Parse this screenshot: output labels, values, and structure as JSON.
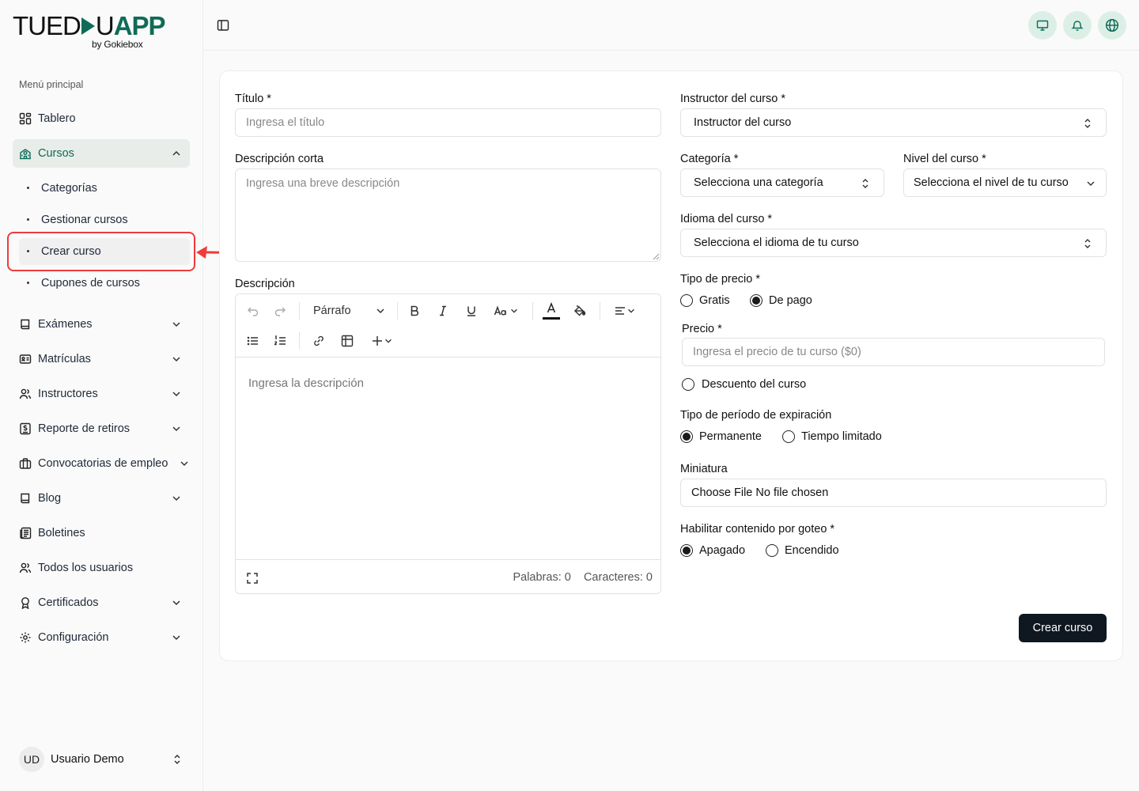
{
  "brand": {
    "logo_text_left": "TUED",
    "logo_text_u": "U",
    "logo_text_app": "APP",
    "logo_sub": "by Gokiebox",
    "accent_color": "#0f6b57"
  },
  "sidebar": {
    "section_label": "Menú principal",
    "items": [
      {
        "label": "Tablero",
        "icon": "dashboard-icon"
      },
      {
        "label": "Cursos",
        "icon": "school-icon",
        "expanded": true
      },
      {
        "label": "Exámenes",
        "icon": "book-icon"
      },
      {
        "label": "Matrículas",
        "icon": "id-card-icon"
      },
      {
        "label": "Instructores",
        "icon": "users-icon"
      },
      {
        "label": "Reporte de retiros",
        "icon": "receipt-icon"
      },
      {
        "label": "Convocatorias de empleo",
        "icon": "briefcase-icon"
      },
      {
        "label": "Blog",
        "icon": "book-open-icon"
      },
      {
        "label": "Boletines",
        "icon": "newspaper-icon"
      },
      {
        "label": "Todos los usuarios",
        "icon": "users-icon"
      },
      {
        "label": "Certificados",
        "icon": "award-icon"
      },
      {
        "label": "Configuración",
        "icon": "gear-icon"
      }
    ],
    "sub_items": [
      {
        "label": "Categorías"
      },
      {
        "label": "Gestionar cursos"
      },
      {
        "label": "Crear curso",
        "current": true
      },
      {
        "label": "Cupones de cursos"
      }
    ],
    "user": {
      "initials": "UD",
      "name": "Usuario Demo"
    }
  },
  "topbar": {
    "icons": [
      "monitor-icon",
      "bell-icon",
      "globe-icon"
    ]
  },
  "form": {
    "title_label": "Título *",
    "title_placeholder": "Ingresa el título",
    "short_desc_label": "Descripción corta",
    "short_desc_placeholder": "Ingresa una breve descripción",
    "desc_label": "Descripción",
    "editor": {
      "block_type": "Párrafo",
      "placeholder": "Ingresa la descripción",
      "words": "Palabras: 0",
      "chars": "Caracteres: 0"
    },
    "instructor_label": "Instructor del curso *",
    "instructor_value": "Instructor del curso",
    "category_label": "Categoría *",
    "category_value": "Selecciona una categoría",
    "level_label": "Nivel del curso *",
    "level_value": "Selecciona el nivel de tu curso",
    "language_label": "Idioma del curso *",
    "language_value": "Selecciona el idioma de tu curso",
    "price_type_label": "Tipo de precio *",
    "price_type_options": [
      "Gratis",
      "De pago"
    ],
    "price_type_selected": "De pago",
    "price_label": "Precio *",
    "price_placeholder": "Ingresa el precio de tu curso ($0)",
    "discount_label": "Descuento del curso",
    "expiration_label": "Tipo de período de expiración",
    "expiration_options": [
      "Permanente",
      "Tiempo limitado"
    ],
    "expiration_selected": "Permanente",
    "thumbnail_label": "Miniatura",
    "file_button": "Choose File",
    "file_status": "No file chosen",
    "drip_label": "Habilitar contenido por goteo *",
    "drip_options": [
      "Apagado",
      "Encendido"
    ],
    "drip_selected": "Apagado",
    "submit_label": "Crear curso"
  },
  "annotation_color": "#ef3b3b"
}
